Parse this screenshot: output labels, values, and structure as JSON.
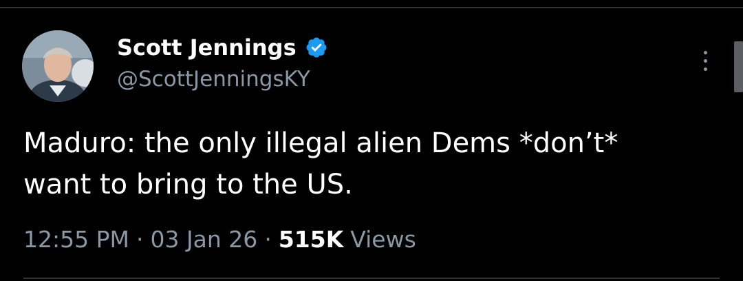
{
  "tweet": {
    "author": {
      "display_name": "Scott Jennings",
      "handle": "@ScottJenningsKY",
      "verified": true,
      "avatar_icon": "profile-photo"
    },
    "text": "Maduro: the only illegal alien Dems *don’t*\nwant to bring to the US.",
    "time": "12:55 PM",
    "date": "03 Jan 26",
    "separator": "·",
    "views_count": "515K",
    "views_label": "Views"
  },
  "colors": {
    "background": "#000000",
    "primary_text": "#ffffff",
    "secondary_text": "#8b98a5",
    "verified_badge": "#1d9bf0",
    "divider": "#2f3336"
  },
  "icons": {
    "verified": "verified-badge-icon",
    "more": "more-options-icon"
  }
}
